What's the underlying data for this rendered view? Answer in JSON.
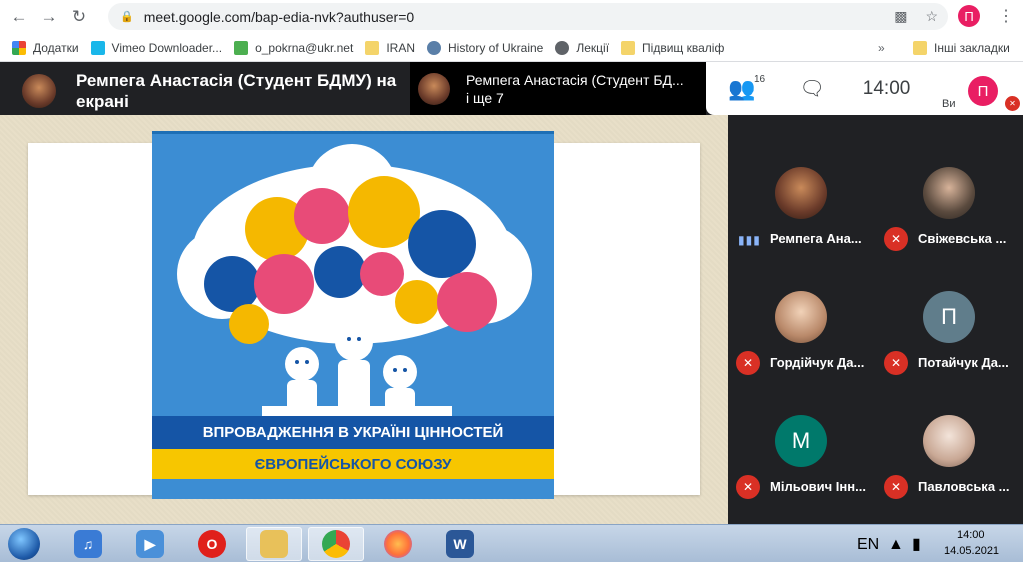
{
  "browser": {
    "url": "meet.google.com/bap-edia-nvk?authuser=0",
    "profile_initial": "П"
  },
  "bookmarks": {
    "items": [
      {
        "label": "Додатки",
        "icon": "apps-grid-icon"
      },
      {
        "label": "Vimeo Downloader...",
        "icon": "vimeo-icon"
      },
      {
        "label": "o_pokrna@ukr.net",
        "icon": "ukrnet-icon"
      },
      {
        "label": "IRAN",
        "icon": "folder-icon"
      },
      {
        "label": "History of Ukraine",
        "icon": "globe-badge-icon"
      },
      {
        "label": "Лекції",
        "icon": "globe-icon"
      },
      {
        "label": "Підвищ кваліф",
        "icon": "folder-icon"
      }
    ],
    "more": "»",
    "other": "Інші закладки"
  },
  "meet": {
    "presenter_title": "Ремпега Анастасія (Студент БДМУ) на екрані",
    "second_presenter_line1": "Ремпега Анастасія (Студент БД...",
    "second_presenter_line2": "і ще 7",
    "people_count": "16",
    "clock": "14:00",
    "me_initial": "П",
    "me_label": "Ви"
  },
  "poster": {
    "line1": "ВПРОВАДЖЕННЯ В УКРАЇНІ ЦІННОСТЕЙ",
    "line2": "ЄВРОПЕЙСЬКОГО СОЮЗУ"
  },
  "participants": [
    {
      "name": "Ремпега Ана...",
      "initial": "",
      "color": "#8b5a3c",
      "muted": false
    },
    {
      "name": "Свіжевська ...",
      "initial": "",
      "color": "#7a6a5a",
      "muted": true
    },
    {
      "name": "Гордійчук Да...",
      "initial": "",
      "color": "#c9a27c",
      "muted": true
    },
    {
      "name": "Потайчук Да...",
      "initial": "П",
      "color": "#607d8b",
      "muted": true
    },
    {
      "name": "Мільович Інн...",
      "initial": "М",
      "color": "#00796b",
      "muted": true
    },
    {
      "name": "Павловська ...",
      "initial": "",
      "color": "#b59a86",
      "muted": true
    }
  ],
  "taskbar": {
    "lang": "EN",
    "time": "14:00",
    "date": "14.05.2021"
  }
}
